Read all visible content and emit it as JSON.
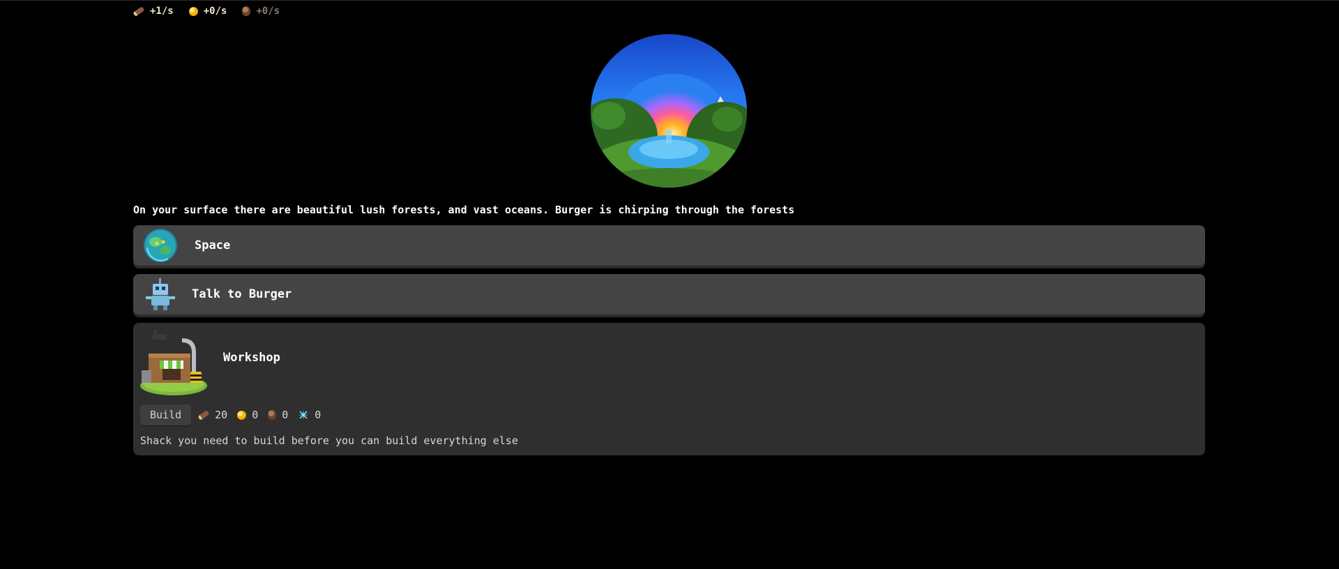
{
  "rates": [
    {
      "icon": "log-icon",
      "value": "+1/s"
    },
    {
      "icon": "coin-icon",
      "value": "+0/s"
    },
    {
      "icon": "acorn-icon",
      "value": "+0/s"
    }
  ],
  "description": "On your surface there are beautiful lush forests, and vast oceans. Burger is chirping through the forests",
  "actions": {
    "space": {
      "label": "Space",
      "icon": "planet-icon"
    },
    "burger": {
      "label": "Talk to Burger",
      "icon": "robot-icon"
    }
  },
  "workshop": {
    "title": "Workshop",
    "icon": "workshop-icon",
    "build_label": "Build",
    "costs": [
      {
        "icon": "log-icon",
        "value": "20"
      },
      {
        "icon": "coin-icon",
        "value": "0"
      },
      {
        "icon": "acorn-icon",
        "value": "0"
      },
      {
        "icon": "crystal-icon",
        "value": "0"
      }
    ],
    "note": "Shack you need to build before you can build everything else"
  },
  "colors": {
    "background": "#000000",
    "card": "#444444",
    "panel": "#2f2f2f",
    "text": "#ffffff"
  }
}
